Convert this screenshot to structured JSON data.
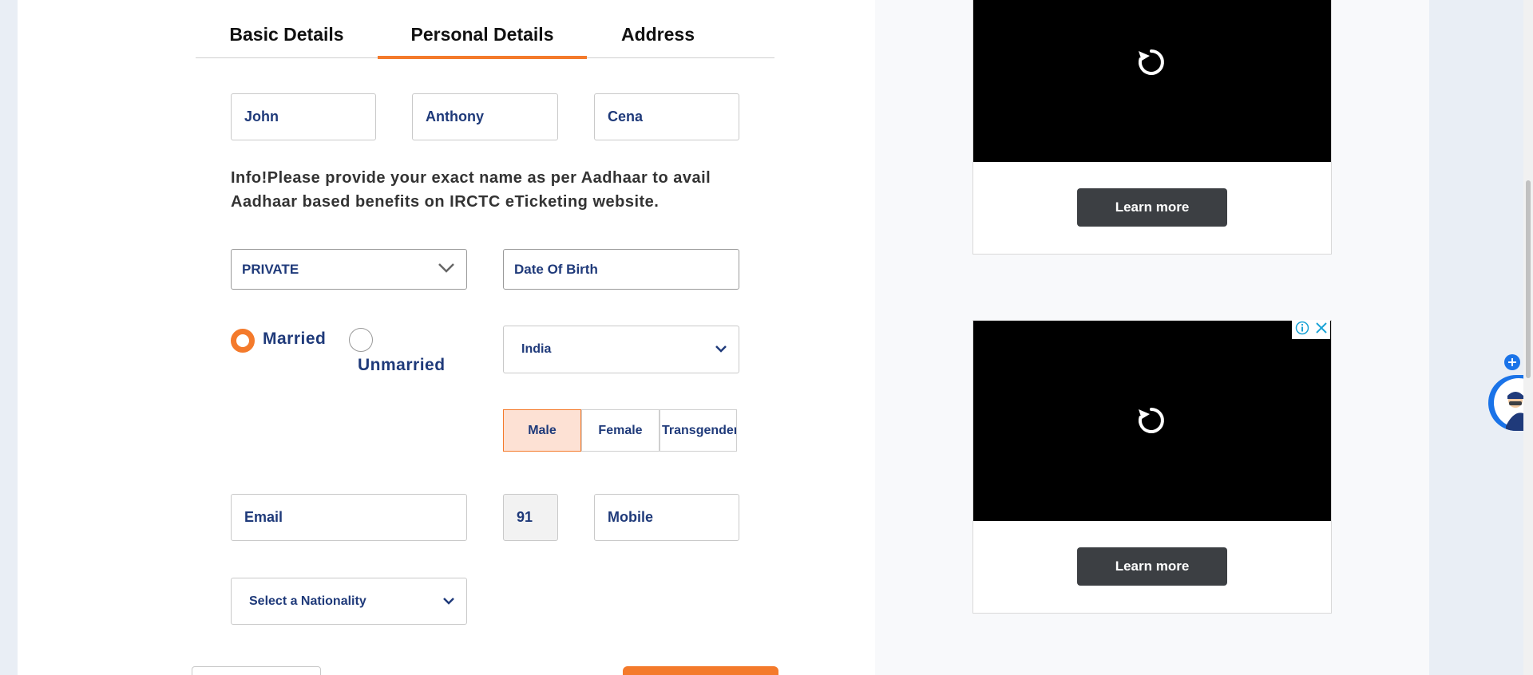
{
  "tabs": [
    {
      "label": "Basic Details",
      "active": false
    },
    {
      "label": "Personal Details",
      "active": true
    },
    {
      "label": "Address",
      "active": false
    }
  ],
  "name_fields": {
    "first_name": "John",
    "middle_name": "Anthony",
    "last_name": "Cena"
  },
  "info_text_line1": "Info!Please provide your exact name as per Aadhaar to avail",
  "info_text_line2": "Aadhaar based benefits on IRCTC eTicketing website.",
  "occupation": {
    "selected": "PRIVATE"
  },
  "dob": {
    "placeholder": "Date Of Birth"
  },
  "marital_status": {
    "options": [
      "Married",
      "Unmarried"
    ],
    "selected": "Married"
  },
  "country": {
    "selected": "India"
  },
  "gender": {
    "options": [
      "Male",
      "Female",
      "Transgender"
    ],
    "selected": "Male"
  },
  "contact": {
    "email_placeholder": "Email",
    "isd_code": "91",
    "mobile_placeholder": "Mobile"
  },
  "nationality": {
    "selected": "Select a Nationality"
  },
  "ads": [
    {
      "button_label": "Learn more"
    },
    {
      "button_label": "Learn more"
    }
  ],
  "colors": {
    "accent": "#f47a2b",
    "text_blue": "#1f3a7a",
    "ad_button": "#3c3f43"
  },
  "icons": [
    "chevron-down-icon",
    "replay-icon",
    "info-icon",
    "close-icon",
    "plus-icon",
    "chatbot-avatar-icon"
  ]
}
